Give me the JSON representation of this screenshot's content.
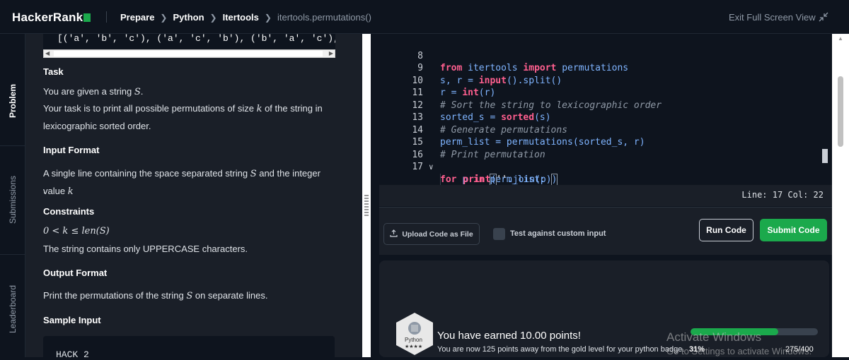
{
  "header": {
    "logo": "HackerRank",
    "breadcrumb": [
      "Prepare",
      "Python",
      "Itertools"
    ],
    "breadcrumb_current": "itertools.permutations()",
    "exit_fullscreen": "Exit Full Screen View"
  },
  "sidenav": {
    "tabs": [
      "Problem",
      "Submissions",
      "Leaderboard"
    ],
    "active": "Problem"
  },
  "problem": {
    "output_fragment": "[('a', 'b', 'c'), ('a', 'c', 'b'), ('b', 'a', 'c'), ('b'",
    "task_title": "Task",
    "task_line1_pre": "You are given a string ",
    "task_var_s": "S",
    "task_line1_post": ".",
    "task_line2_pre": "Your task is to print all possible permutations of size ",
    "task_var_k": "k",
    "task_line2_post": " of the string in",
    "task_line3": "lexicographic sorted order.",
    "input_title": "Input Format",
    "input_pre": "A single line containing the space separated string ",
    "input_mid": " and the integer value ",
    "input_post": ".",
    "constraints_title": "Constraints",
    "constraint_formula": "0 < k ≤ len(S)",
    "constraint_text": "The string contains only UPPERCASE characters.",
    "output_title": "Output Format",
    "output_pre": "Print the permutations of the string ",
    "output_post": " on separate lines.",
    "sample_title": "Sample Input",
    "sample_value": "HACK 2"
  },
  "editor": {
    "lines": [
      {
        "n": "8",
        "code": "from itertools import permutations"
      },
      {
        "n": "9",
        "code": "s, r = input().split()"
      },
      {
        "n": "10",
        "code": "r = int(r)"
      },
      {
        "n": "11",
        "code": "# Sort the string to lexicographic order"
      },
      {
        "n": "12",
        "code": "sorted_s = sorted(s)"
      },
      {
        "n": "13",
        "code": "# Generate permutations"
      },
      {
        "n": "14",
        "code": "perm_list = permutations(sorted_s, r)"
      },
      {
        "n": "15",
        "code": "# Print permutation"
      },
      {
        "n": "16",
        "code": "for p in perm_list:"
      },
      {
        "n": "17",
        "code": "    print(''.join(p))"
      }
    ],
    "status": "Line: 17 Col: 22"
  },
  "actions": {
    "upload": "Upload Code as File",
    "custom_input": "Test against custom input",
    "run": "Run Code",
    "submit": "Submit Code"
  },
  "result": {
    "earned": "You have earned 10.00 points!",
    "away": "You are now 125 points away from the gold level for your python badge.",
    "badge_label": "Python",
    "badge_stars": "★★★★",
    "progress_pct_text": "31%",
    "progress_fraction": 0.6875,
    "points": "275/400"
  },
  "watermark": {
    "title": "Activate Windows",
    "subtitle": "Go to Settings to activate Windows."
  },
  "colors": {
    "accent": "#1ba94c",
    "keyword": "#ff5f8f",
    "name": "#7fb4ff",
    "comment": "#8f99a6",
    "background": "#0e141e"
  }
}
